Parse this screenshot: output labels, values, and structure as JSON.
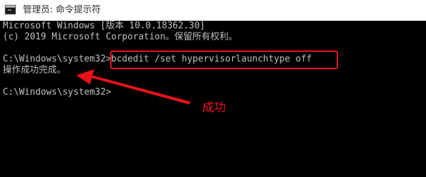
{
  "window": {
    "title": "管理员: 命令提示符",
    "icon": "cmd-icon"
  },
  "console": {
    "lines": [
      "Microsoft Windows [版本 10.0.18362.30]",
      "(c) 2019 Microsoft Corporation。保留所有权利。",
      "",
      "C:\\Windows\\system32>bcdedit /set hypervisorlaunchtype off",
      "操作成功完成。",
      "",
      "C:\\Windows\\system32>"
    ]
  },
  "annotation": {
    "label": "成功",
    "color": "#e8121b"
  }
}
